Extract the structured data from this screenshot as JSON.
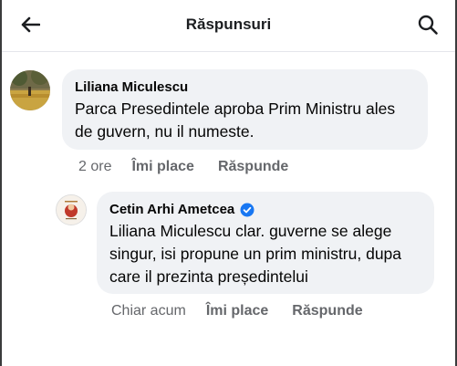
{
  "header": {
    "title": "Răspunsuri"
  },
  "comments": [
    {
      "author": "Liliana Miculescu",
      "lines": [
        "Parca Presedintele aproba Prim Ministru ales",
        "de guvern, nu il numeste."
      ],
      "time": "2 ore",
      "like_label": "Îmi place",
      "reply_label": "Răspunde"
    },
    {
      "author": "Cetin Arhi Ametcea",
      "verified": true,
      "lines": [
        "Liliana Miculescu clar. guverne se alege",
        "singur, isi propune un prim ministru, dupa",
        "care il prezinta președintelui"
      ],
      "time": "Chiar acum",
      "like_label": "Îmi place",
      "reply_label": "Răspunde"
    }
  ],
  "colors": {
    "bubble": "#f0f2f5",
    "meta_text": "#65676b",
    "verified": "#1877f2"
  }
}
